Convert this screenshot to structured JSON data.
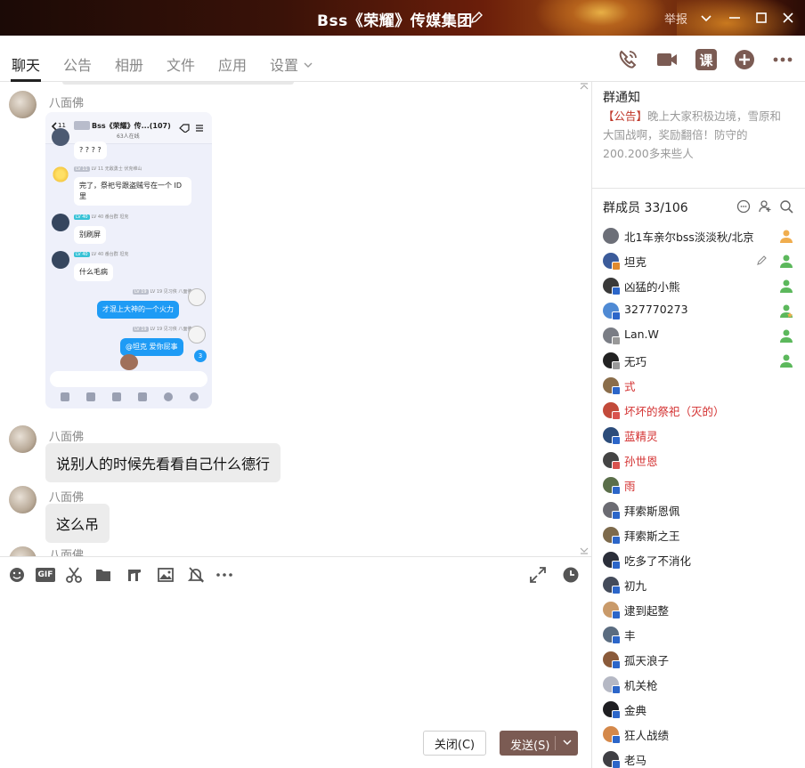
{
  "window": {
    "title": "Bss《荣耀》传媒集团",
    "report_label": "举报"
  },
  "tabs": [
    {
      "label": "聊天"
    },
    {
      "label": "公告"
    },
    {
      "label": "相册"
    },
    {
      "label": "文件"
    },
    {
      "label": "应用"
    },
    {
      "label": "设置"
    }
  ],
  "top_icons": [
    "phone-call-icon",
    "video-call-icon",
    "class-icon",
    "add-icon",
    "more-icon"
  ],
  "top_icon_class_label": "课",
  "chat": {
    "messages": [
      {
        "sender": "八面佛",
        "type": "image",
        "screenshot": {
          "header_title": "Bss《荣耀》传...(107)",
          "header_sub": "63人在线",
          "back_count": "11",
          "items": [
            {
              "side": "left",
              "text": "? ? ? ?"
            },
            {
              "side": "left",
              "name": "LV 11 无敌勇士  伏克维山",
              "text": "完了，祭祀号跟盗贼号在一个 ID 里"
            },
            {
              "side": "left",
              "name": "LV 40 番台群  坦克",
              "text": "别刷屏"
            },
            {
              "side": "left",
              "name": "LV 40 番台群  坦克",
              "text": "什么毛病"
            },
            {
              "side": "right",
              "name": "LV 19 见习侠  八面佛",
              "text": "才混上大神的一个火力"
            },
            {
              "side": "right",
              "name": "LV 19 见习侠  八面佛",
              "text": "@坦克 爱你屁事"
            }
          ],
          "unread_badge": "3"
        }
      },
      {
        "sender": "八面佛",
        "type": "text",
        "text": "说别人的时候先看看自己什么德行"
      },
      {
        "sender": "八面佛",
        "type": "text",
        "text": "这么吊"
      },
      {
        "sender": "八面佛",
        "type": "partial"
      }
    ]
  },
  "toolbar": {
    "tools": [
      "emoji-icon",
      "gif-icon",
      "scissors-icon",
      "folder-icon",
      "music-icon",
      "image-icon",
      "mute-bell-icon",
      "more-icon"
    ],
    "right_tools": [
      "expand-icon",
      "history-icon"
    ],
    "gif_label": "GIF"
  },
  "input": {
    "value": ""
  },
  "buttons": {
    "close_label": "关闭(C)",
    "send_label": "发送(S)"
  },
  "notice": {
    "title": "群通知",
    "tag": "【公告】",
    "body": "晚上大家积极边境，雪原和大国战啊，奖励翻倍！防守的200.200多来些人"
  },
  "members_header": {
    "title": "群成员 33/106"
  },
  "members": [
    {
      "name": "北1车亲尔bss淡淡秋/北京",
      "red": false,
      "role": "owner"
    },
    {
      "name": "坦克",
      "red": false,
      "role": "admin",
      "editable": true
    },
    {
      "name": "凶猛的小熊",
      "red": false,
      "role": "admin"
    },
    {
      "name": "327770273",
      "red": false,
      "role": "admin-star"
    },
    {
      "name": "Lan.W",
      "red": false,
      "role": "admin"
    },
    {
      "name": "无巧",
      "red": false,
      "role": "admin"
    },
    {
      "name": "式",
      "red": true,
      "role": ""
    },
    {
      "name": "坏坏的祭祀（灭的）",
      "red": true,
      "role": ""
    },
    {
      "name": "蓝精灵",
      "red": true,
      "role": ""
    },
    {
      "name": "孙世恩",
      "red": true,
      "role": ""
    },
    {
      "name": "雨",
      "red": true,
      "role": ""
    },
    {
      "name": "拜索斯恩佩",
      "red": false,
      "role": ""
    },
    {
      "name": "拜索斯之王",
      "red": false,
      "role": ""
    },
    {
      "name": "吃多了不消化",
      "red": false,
      "role": ""
    },
    {
      "name": "初九",
      "red": false,
      "role": ""
    },
    {
      "name": "逮到起整",
      "red": false,
      "role": ""
    },
    {
      "name": "丰",
      "red": false,
      "role": ""
    },
    {
      "name": "孤天浪子",
      "red": false,
      "role": ""
    },
    {
      "name": "机关枪",
      "red": false,
      "role": ""
    },
    {
      "name": "金典",
      "red": false,
      "role": ""
    },
    {
      "name": "狂人战绩",
      "red": false,
      "role": ""
    },
    {
      "name": "老马",
      "red": false,
      "role": ""
    }
  ],
  "colors": {
    "send_button": "#7b5b53",
    "red_name": "#d32f2f",
    "admin_icon": "#5cb85c",
    "owner_icon": "#f0ad4e"
  }
}
